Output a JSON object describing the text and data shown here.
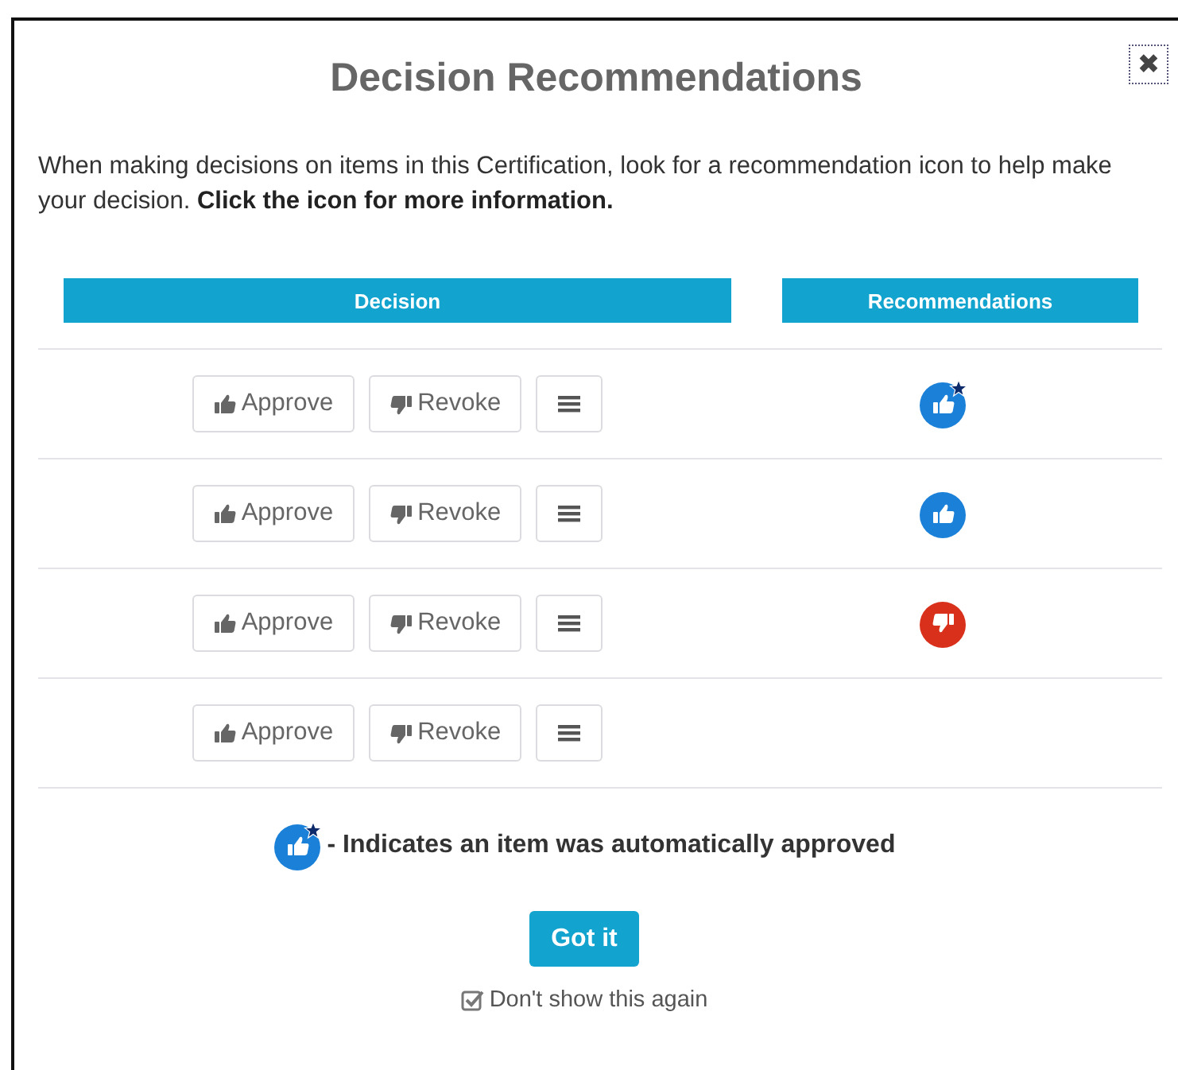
{
  "dialog": {
    "title": "Decision Recommendations",
    "close_label": "✖"
  },
  "intro": "When making decisions on items in this Certification, look for a recommendation icon to help make your decision. **Click the icon for more information.**",
  "table": {
    "columns": [
      "Decision",
      "Recommendations"
    ],
    "rows": [
      {
        "approve": "Approve",
        "revoke": "Revoke",
        "kind": "autoapproved"
      },
      {
        "approve": "Approve",
        "revoke": "Revoke",
        "kind": "approve"
      },
      {
        "approve": "Approve",
        "revoke": "Revoke",
        "kind": "revoke"
      },
      {
        "approve": "Approve",
        "revoke": "Revoke",
        "kind": "blank"
      }
    ]
  },
  "legend": {
    "text": "- Indicates an item was automatically approved"
  },
  "confirm_button": "Got it",
  "dont_show": {
    "label": "Don't show this again",
    "checked": true
  }
}
